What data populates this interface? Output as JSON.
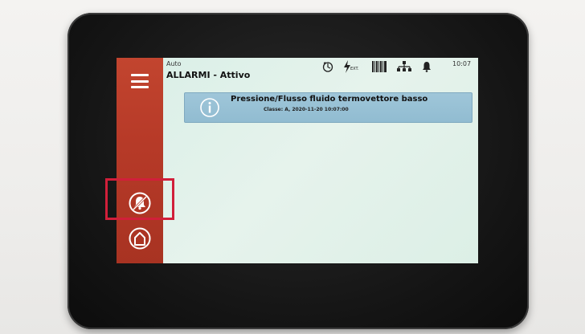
{
  "status_bar": {
    "mode": "Auto",
    "clock": "10:07",
    "icons": [
      "timer-icon",
      "external-power-icon",
      "barcode-icon",
      "network-icon",
      "bell-icon"
    ],
    "external_label": "EXT."
  },
  "header": {
    "title": "ALLARMI - Attivo"
  },
  "sidebar": {
    "items": [
      {
        "name": "menu-icon"
      },
      {
        "name": "alarm-silence-icon",
        "highlighted": true
      },
      {
        "name": "home-icon"
      }
    ],
    "color": "#b73a28"
  },
  "alarms": [
    {
      "title": "Pressione/Flusso fluido termovettore basso",
      "details": "Classe: A, 2020-11-20 10:07:00",
      "icon": "info-icon",
      "color": "#9fc6d9"
    }
  ],
  "highlight_color": "#d11f3a"
}
